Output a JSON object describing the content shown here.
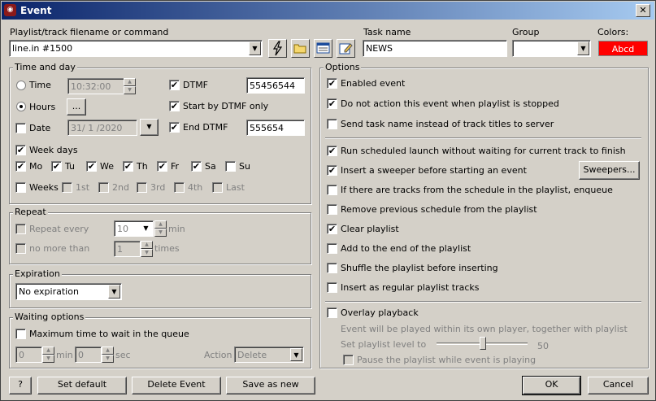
{
  "window": {
    "title": "Event",
    "close_glyph": "✕",
    "app_icon_glyph": "◉"
  },
  "top": {
    "playlist_label": "Playlist/track filename or command",
    "playlist_value": "line.in #1500",
    "task_label": "Task name",
    "task_value": "NEWS",
    "group_label": "Group",
    "group_value": "",
    "colors_label": "Colors:",
    "color_sample": "Abcd",
    "color_bg": "#ff0000",
    "color_fg": "#ffffff"
  },
  "time_and_day": {
    "title": "Time and day",
    "time_label": "Time",
    "time_value": "10:32:00",
    "hours_label": "Hours",
    "hours_button": "...",
    "date_label": "Date",
    "date_value": "31/ 1 /2020",
    "dtmf_label": "DTMF",
    "dtmf_value": "55456544",
    "start_dtmf_label": "Start by DTMF only",
    "end_dtmf_label": "End DTMF",
    "end_dtmf_value": "555654",
    "week_days_label": "Week days",
    "days": [
      "Mo",
      "Tu",
      "We",
      "Th",
      "Fr",
      "Sa",
      "Su"
    ],
    "weeks_label": "Weeks",
    "weeks": [
      "1st",
      "2nd",
      "3rd",
      "4th",
      "Last"
    ]
  },
  "repeat": {
    "title": "Repeat",
    "repeat_every_label": "Repeat every",
    "repeat_every_value": "10",
    "repeat_unit": "min",
    "no_more_label": "no more than",
    "no_more_value": "1",
    "no_more_unit": "times"
  },
  "expiration": {
    "title": "Expiration",
    "value": "No expiration"
  },
  "waiting": {
    "title": "Waiting options",
    "max_time_label": "Maximum time to wait in the queue",
    "min_value": "0",
    "min_unit": "min",
    "sec_value": "0",
    "sec_unit": "sec",
    "action_label": "Action",
    "action_value": "Delete"
  },
  "options": {
    "title": "Options",
    "enabled": "Enabled event",
    "no_action": "Do not action this event when playlist is stopped",
    "send_task": "Send task name instead of track titles to server",
    "run_sched": "Run scheduled launch without waiting for current track to finish",
    "sweeper": "Insert a sweeper before starting an event",
    "sweepers_button": "Sweepers...",
    "enqueue": "If there are tracks from the schedule in the playlist, enqueue",
    "remove_prev": "Remove previous schedule from the playlist",
    "clear": "Clear playlist",
    "add_end": "Add to the end of the playlist",
    "shuffle": "Shuffle the playlist before inserting",
    "regular": "Insert as regular playlist tracks",
    "overlay": "Overlay playback",
    "overlay_note": "Event will be played within its own player, together with playlist",
    "level_label": "Set playlist level to",
    "level_value": "50",
    "pause": "Pause the playlist while event is playing"
  },
  "bottom": {
    "help": "?",
    "set_default": "Set default",
    "delete_event": "Delete Event",
    "save_as_new": "Save as new",
    "ok": "OK",
    "cancel": "Cancel"
  },
  "check_glyph": "✔",
  "dropdown_glyph": "▼",
  "spin_up": "▲",
  "spin_down": "▼"
}
